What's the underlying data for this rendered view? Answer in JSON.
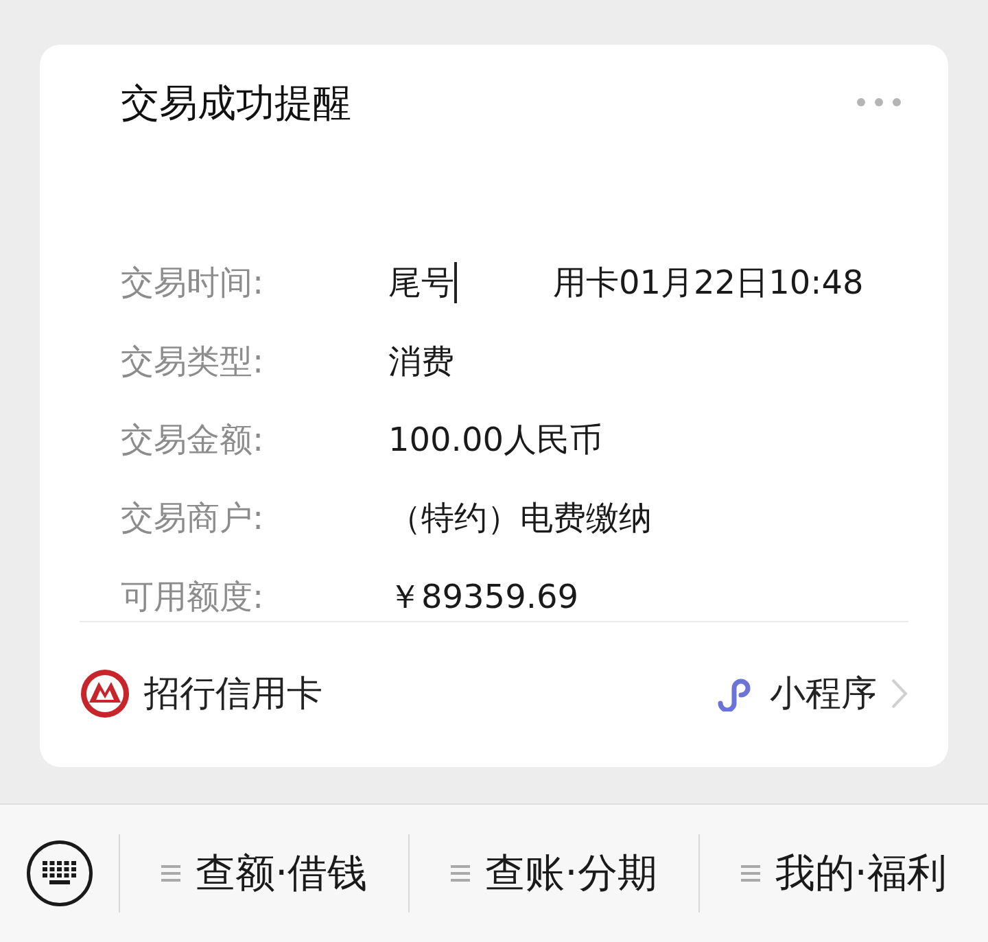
{
  "card": {
    "title": "交易成功提醒",
    "fields": [
      {
        "kind": "redacted",
        "label": "交易时间:",
        "value": "尾号",
        "value_after": "用卡01月22日10:48"
      },
      {
        "kind": "plain",
        "label": "交易类型:",
        "value": "消费"
      },
      {
        "kind": "plain",
        "label": "交易金额:",
        "value": "100.00人民币"
      },
      {
        "kind": "plain",
        "label": "交易商户:",
        "value": "（特约）电费缴纳"
      },
      {
        "kind": "plain",
        "label": "可用额度:",
        "value": "￥89359.69"
      }
    ],
    "source": "招行信用卡",
    "link": "小程序"
  },
  "menu": [
    {
      "label": "查额·借钱"
    },
    {
      "label": "查账·分期"
    },
    {
      "label": "我的·福利"
    }
  ]
}
